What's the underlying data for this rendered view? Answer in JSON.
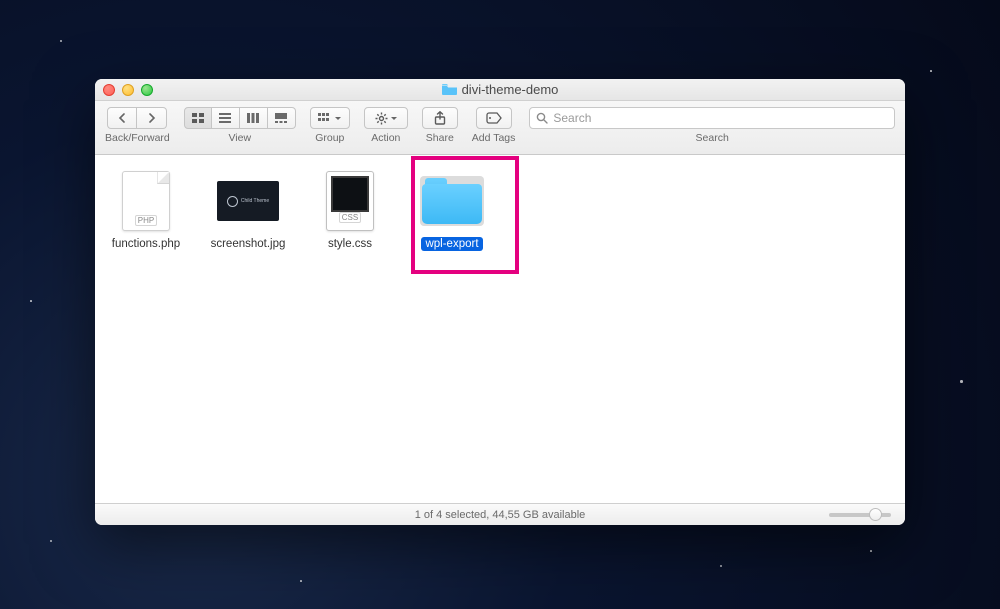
{
  "window": {
    "title": "divi-theme-demo"
  },
  "toolbar": {
    "back_forward_label": "Back/Forward",
    "view_label": "View",
    "group_label": "Group",
    "action_label": "Action",
    "share_label": "Share",
    "tags_label": "Add Tags",
    "search_label": "Search",
    "search_placeholder": "Search"
  },
  "files": [
    {
      "name": "functions.php",
      "type": "php",
      "badge": "PHP",
      "selected": false
    },
    {
      "name": "screenshot.jpg",
      "type": "image",
      "selected": false
    },
    {
      "name": "style.css",
      "type": "css",
      "badge": "CSS",
      "selected": false
    },
    {
      "name": "wpl-export",
      "type": "folder",
      "selected": true
    }
  ],
  "status": {
    "text": "1 of 4 selected, 44,55 GB available"
  },
  "highlight": {
    "target": "wpl-export"
  }
}
